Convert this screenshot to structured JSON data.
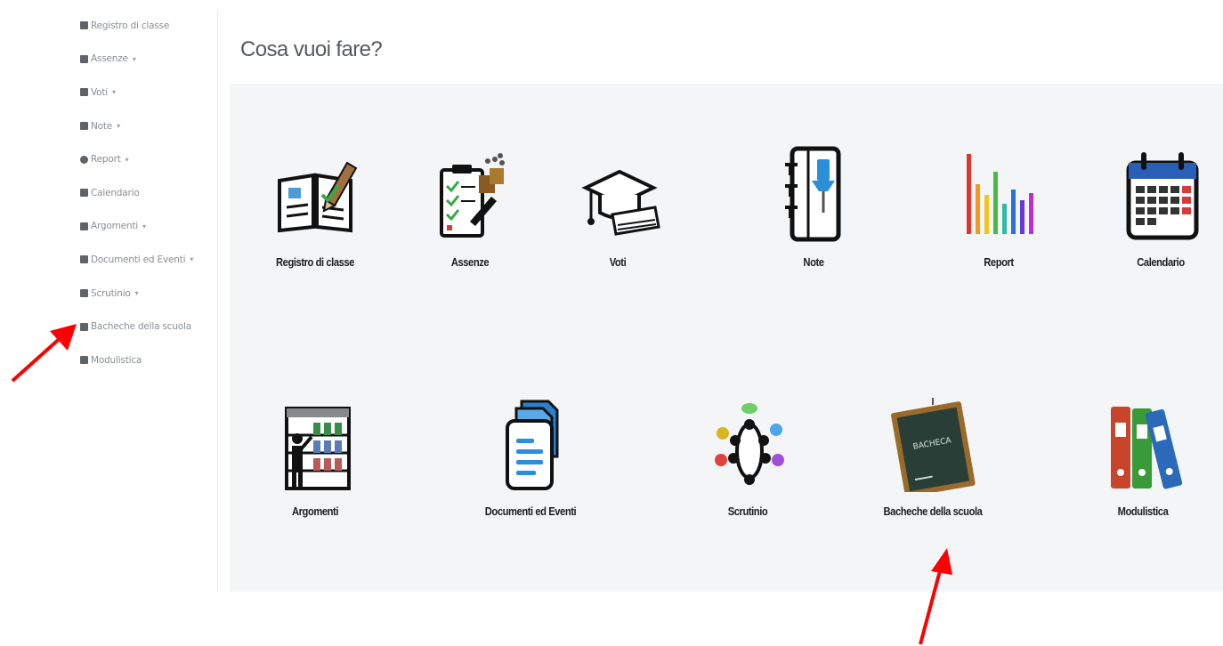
{
  "sidebar": {
    "items": [
      {
        "label": "Registro di classe",
        "caret": ""
      },
      {
        "label": "Assenze",
        "caret": "▾"
      },
      {
        "label": "Voti",
        "caret": "▾"
      },
      {
        "label": "Note",
        "caret": "▾"
      },
      {
        "label": "Report",
        "caret": "▾"
      },
      {
        "label": "Calendario",
        "caret": ""
      },
      {
        "label": "Argomenti",
        "caret": "▾"
      },
      {
        "label": "Documenti ed Eventi",
        "caret": "▾"
      },
      {
        "label": "Scrutinio",
        "caret": "▾"
      },
      {
        "label": "Bacheche della scuola",
        "caret": ""
      },
      {
        "label": "Modulistica",
        "caret": ""
      }
    ]
  },
  "header": {
    "title": "Cosa vuoi fare?"
  },
  "tiles": [
    {
      "label": "Registro di classe"
    },
    {
      "label": "Assenze"
    },
    {
      "label": "Voti"
    },
    {
      "label": "Note"
    },
    {
      "label": "Report"
    },
    {
      "label": "Calendario"
    },
    {
      "label": "Argomenti"
    },
    {
      "label": "Documenti ed Eventi"
    },
    {
      "label": "Scrutinio"
    },
    {
      "label": "Bacheche della scuola"
    },
    {
      "label": "Modulistica"
    }
  ],
  "icons": {
    "registro": "book-pencil-icon",
    "assenze": "clipboard-checklist-icon",
    "voti": "graduation-cap-icon",
    "note": "pinned-notebook-icon",
    "report": "bar-chart-icon",
    "calendario": "calendar-icon",
    "argomenti": "bookshelf-icon",
    "documenti": "documents-icon",
    "scrutinio": "meeting-table-icon",
    "bacheche": "chalkboard-icon",
    "modulistica": "binders-icon"
  },
  "chalkboard_text": "BACHECA",
  "colors": {
    "annotation_arrow": "#ff0000",
    "panel_bg": "#f4f5f6"
  }
}
